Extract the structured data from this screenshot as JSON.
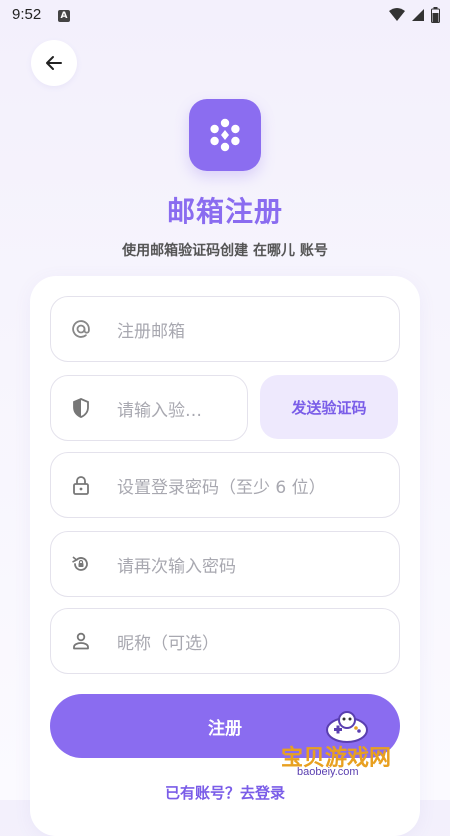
{
  "status_bar": {
    "time": "9:52",
    "notification_icon": "A"
  },
  "header": {
    "back_icon": "arrow-left-icon"
  },
  "brand": {
    "logo_icon": "flower-icon",
    "accent_color": "#8a6cf0"
  },
  "title": "邮箱注册",
  "subtitle": "使用邮箱验证码创建 在哪儿 账号",
  "form": {
    "email_placeholder": "注册邮箱",
    "code_placeholder": "请输入验…",
    "send_code_label": "发送验证码",
    "password_placeholder": "设置登录密码（至少 6 位）",
    "confirm_password_placeholder": "请再次输入密码",
    "nickname_placeholder": "昵称（可选）",
    "submit_label": "注册",
    "login_link": "已有账号？去登录"
  },
  "watermark": {
    "text": "宝贝游戏网",
    "url": "baobeiy.com"
  }
}
